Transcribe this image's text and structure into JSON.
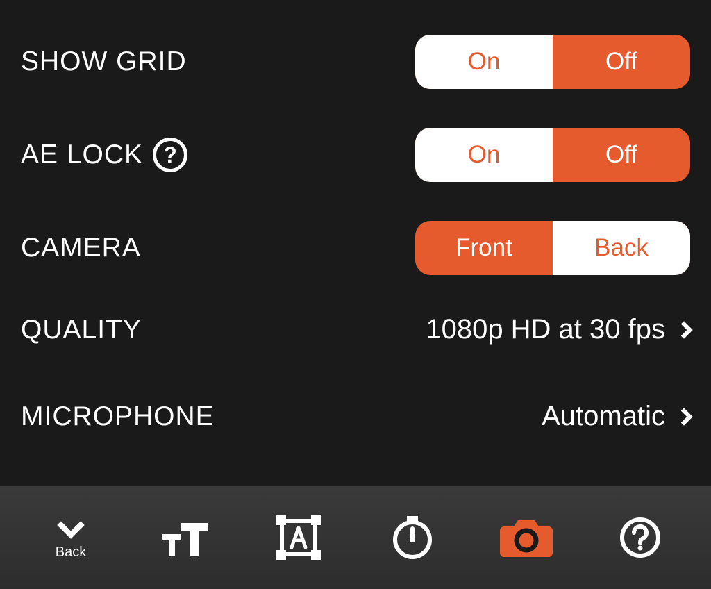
{
  "settings": {
    "showGrid": {
      "label": "SHOW GRID",
      "options": [
        "On",
        "Off"
      ],
      "selected": "On"
    },
    "aeLock": {
      "label": "AE LOCK",
      "options": [
        "On",
        "Off"
      ],
      "selected": "On"
    },
    "camera": {
      "label": "CAMERA",
      "options": [
        "Front",
        "Back"
      ],
      "selected": "Back"
    },
    "quality": {
      "label": "QUALITY",
      "value": "1080p HD at 30 fps"
    },
    "microphone": {
      "label": "MICROPHONE",
      "value": "Automatic"
    }
  },
  "toolbar": {
    "back": "Back"
  },
  "colors": {
    "accent": "#e65b2e",
    "background": "#1a1a1a",
    "toolbar": "#333333"
  }
}
